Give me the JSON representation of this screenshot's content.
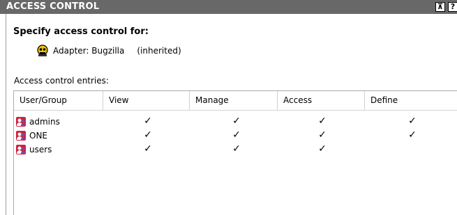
{
  "titlebar": {
    "title": "ACCESS CONTROL",
    "pin_glyph": "⊼",
    "help_glyph": "?"
  },
  "heading": "Specify access control for:",
  "adapter": {
    "icon": "adapter-icon",
    "label": "Adapter: Bugzilla",
    "inherited": "(inherited)"
  },
  "entries_label": "Access control entries:",
  "table": {
    "columns": [
      "User/Group",
      "View",
      "Manage",
      "Access",
      "Define"
    ],
    "rows": [
      {
        "name": "admins",
        "icon": "group-icon",
        "view": true,
        "manage": true,
        "access": true,
        "define": true
      },
      {
        "name": "ONE",
        "icon": "group-icon",
        "view": true,
        "manage": true,
        "access": true,
        "define": true
      },
      {
        "name": "users",
        "icon": "group-icon",
        "view": true,
        "manage": true,
        "access": true,
        "define": false
      }
    ]
  },
  "check_glyph": "✓",
  "colors": {
    "titlebar_bg": "#686868",
    "group_icon_red": "#cc2244",
    "group_icon_purple": "#7b4a9c"
  }
}
